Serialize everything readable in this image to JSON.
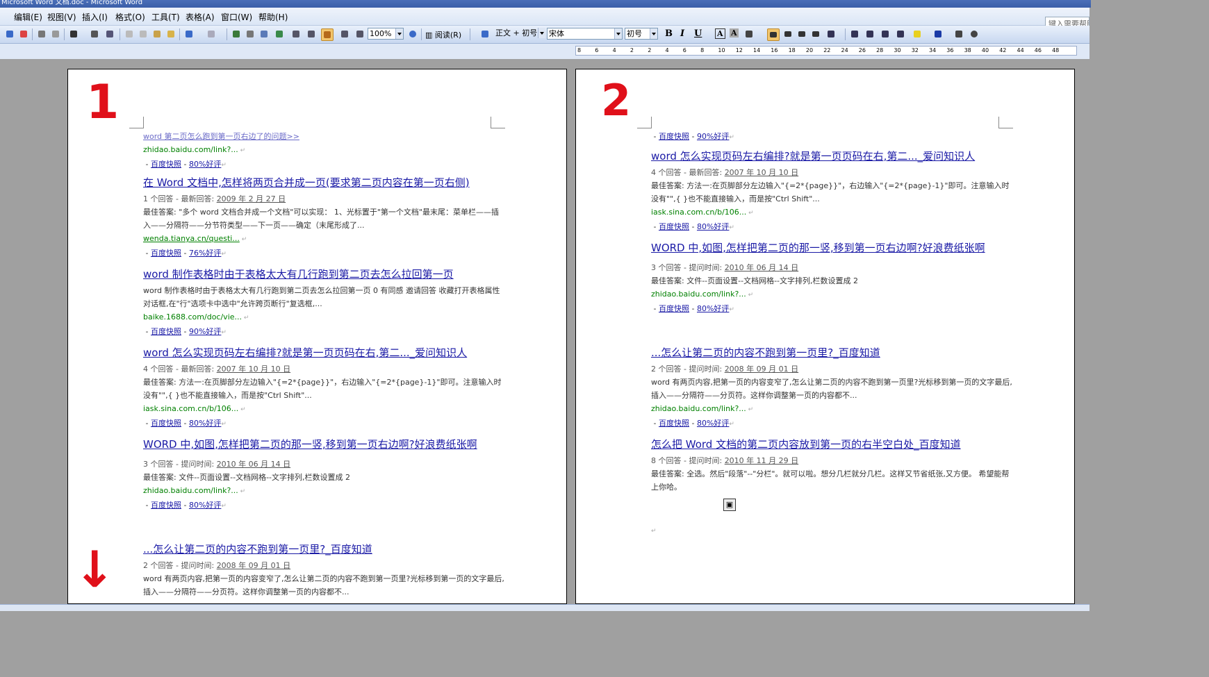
{
  "window": {
    "title": "Microsoft Word 文档.doc - Microsoft Word"
  },
  "menu": {
    "items": [
      "编辑(E)",
      "视图(V)",
      "插入(I)",
      "格式(O)",
      "工具(T)",
      "表格(A)",
      "窗口(W)",
      "帮助(H)"
    ],
    "help_placeholder": "键入需要帮助"
  },
  "toolbar": {
    "zoom": "100%",
    "read_label": "阅读(R)",
    "style": "正文 + 初号",
    "font": "宋体",
    "font_size": "初号"
  },
  "ruler": {
    "ticks": [
      "8",
      "6",
      "4",
      "2",
      "2",
      "4",
      "6",
      "8",
      "10",
      "12",
      "14",
      "16",
      "18",
      "20",
      "22",
      "24",
      "26",
      "28",
      "30",
      "32",
      "34",
      "36",
      "38",
      "40",
      "42",
      "44",
      "46",
      "48"
    ]
  },
  "annotations": {
    "page1_mark": "1",
    "page2_mark": "2",
    "arrow": "↓"
  },
  "page1": {
    "r0": {
      "title": "word 第二页怎么跑到第一页右边了的问题>>",
      "url": "zhidao.baidu.com/link?...",
      "rating": "80%好评"
    },
    "r1": {
      "title_pre": "在 Word 文档中,怎样将两页合并成一页(要求第二页内容在第一页右侧)",
      "meta_count": "1 个回答",
      "meta_label": "最新回答:",
      "meta_date": "2009 年 2 月 27 日",
      "ans": "最佳答案: \"多个 word 文档合并成一个文档\"可以实现： 1、光标置于\"第一个文档\"最末尾：菜单栏——插入——分隔符——分节符类型——下一页——确定（末尾形成了...",
      "url": "wenda.tianya.cn/questi...",
      "rating": "76%好评"
    },
    "r2": {
      "title": "word 制作表格时由于表格太大有几行跑到第二页去怎么拉回第一页",
      "snip": "word 制作表格时由于表格太大有几行跑到第二页去怎么拉回第一页 0 有同感 邀请回答 收藏打开表格属性对话框,在\"行\"选项卡中选中\"允许跨页断行\"复选框,...",
      "url": "baike.1688.com/doc/vie...",
      "rating": "90%好评"
    },
    "r3": {
      "title": "word 怎么实现页码左右编排?就是第一页页码在右,第二..._爱问知识人",
      "meta_count": "4 个回答",
      "meta_label": "最新回答:",
      "meta_date": "2007 年 10 月 10 日",
      "ans": "最佳答案: 方法一:在页脚部分左边输入\"{=2*{page}}\"，右边输入\"{=2*{page}-1}\"即可。注意输入时没有\"\",{ }也不能直接输入，而是按\"Ctrl Shift\"...",
      "url": "iask.sina.com.cn/b/106...",
      "rating": "80%好评"
    },
    "r4": {
      "title": "WORD 中,如图,怎样把第二页的那一竖,移到第一页右边啊?好浪费纸张啊",
      "meta_count": "3 个回答",
      "meta_label": "提问时间:",
      "meta_date": "2010 年 06 月 14 日",
      "ans": "最佳答案: 文件--页面设置--文档网格--文字排列,栏数设置成 2",
      "url": "zhidao.baidu.com/link?...",
      "rating": "80%好评"
    },
    "r5": {
      "title": "...怎么让第二页的内容不跑到第一页里?_百度知道",
      "meta_count": "2 个回答",
      "meta_label": "提问时间:",
      "meta_date": "2008 年 09 月 01 日",
      "snip": "word 有两页内容,把第一页的内容变窄了,怎么让第二页的内容不跑到第一页里?光标移到第一页的文字最后,插入——分隔符——分页符。这样你调整第一页的内容都不..."
    }
  },
  "page2": {
    "r0": {
      "rating": "90%好评"
    },
    "r1": {
      "title": "word 怎么实现页码左右编排?就是第一页页码在右,第二..._爱问知识人",
      "meta_count": "4 个回答",
      "meta_label": "最新回答:",
      "meta_date": "2007 年 10 月 10 日",
      "ans": "最佳答案: 方法一:在页脚部分左边输入\"{=2*{page}}\"，右边输入\"{=2*{page}-1}\"即可。注意输入时没有\"\",{ }也不能直接输入，而是按\"Ctrl Shift\"...",
      "url": "iask.sina.com.cn/b/106...",
      "rating": "80%好评"
    },
    "r2": {
      "title": "WORD 中,如图,怎样把第二页的那一竖,移到第一页右边啊?好浪费纸张啊",
      "meta_count": "3 个回答",
      "meta_label": "提问时间:",
      "meta_date": "2010 年 06 月 14 日",
      "ans": "最佳答案: 文件--页面设置--文档网格--文字排列,栏数设置成 2",
      "url": "zhidao.baidu.com/link?...",
      "rating": "80%好评"
    },
    "r3": {
      "title": "...怎么让第二页的内容不跑到第一页里?_百度知道",
      "meta_count": "2 个回答",
      "meta_label": "提问时间:",
      "meta_date": "2008 年 09 月 01 日",
      "snip": "word 有两页内容,把第一页的内容变窄了,怎么让第二页的内容不跑到第一页里?光标移到第一页的文字最后,插入——分隔符——分页符。这样你调整第一页的内容都不...",
      "url": "zhidao.baidu.com/link?...",
      "rating": "80%好评"
    },
    "r4": {
      "title": "怎么把 Word 文档的第二页内容放到第一页的右半空白处_百度知道",
      "meta_count": "8 个回答",
      "meta_label": "提问时间:",
      "meta_date": "2010 年 11 月 29 日",
      "ans": "最佳答案: 全选。然后\"段落\"--\"分栏\"。就可以啦。想分几栏就分几栏。这样又节省纸张,又方便。 希望能帮上你哈。"
    }
  },
  "common": {
    "snapshot": "百度快照",
    "dash": "-"
  }
}
